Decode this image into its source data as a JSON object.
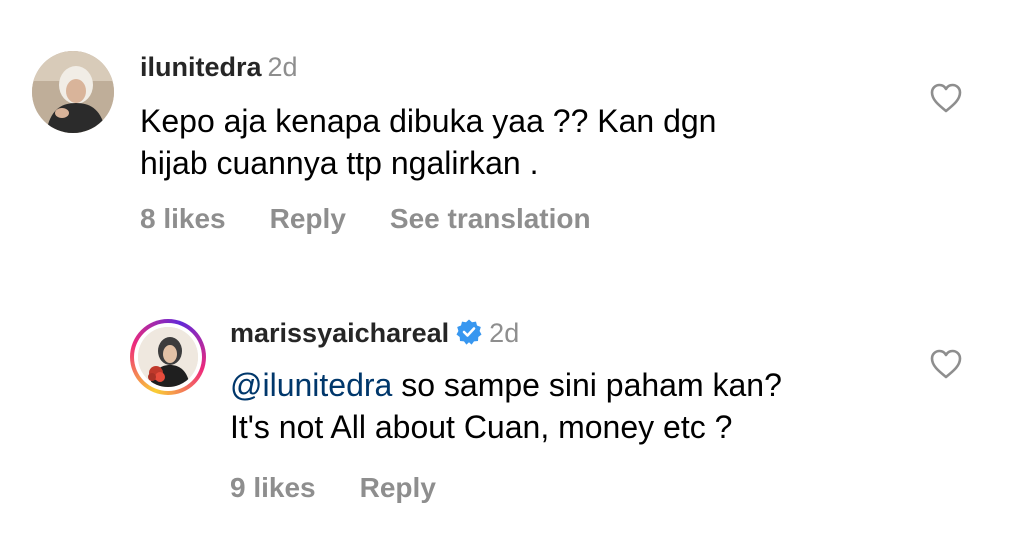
{
  "comments": [
    {
      "username": "ilunitedra",
      "time": "2d",
      "text_lines": [
        "Kepo aja kenapa dibuka yaa ?? Kan dgn",
        "hijab cuannya ttp ngalirkan ."
      ],
      "likes": "8 likes",
      "reply": "Reply",
      "see_translation": "See translation",
      "verified": false,
      "icons": {
        "like": "heart-outline-icon"
      }
    },
    {
      "username": "marissyaichareal",
      "time": "2d",
      "mention": "@ilunitedra",
      "text_line1_rest": " so sampe sini paham kan?",
      "text_line2": "It's not All about Cuan, money etc ?",
      "likes": "9 likes",
      "reply": "Reply",
      "verified": true,
      "icons": {
        "like": "heart-outline-icon",
        "badge": "verified-badge-icon"
      }
    }
  ],
  "colors": {
    "username": "#262626",
    "secondary": "#8e8e8e",
    "mention": "#00376b",
    "verified": "#0095f6"
  }
}
